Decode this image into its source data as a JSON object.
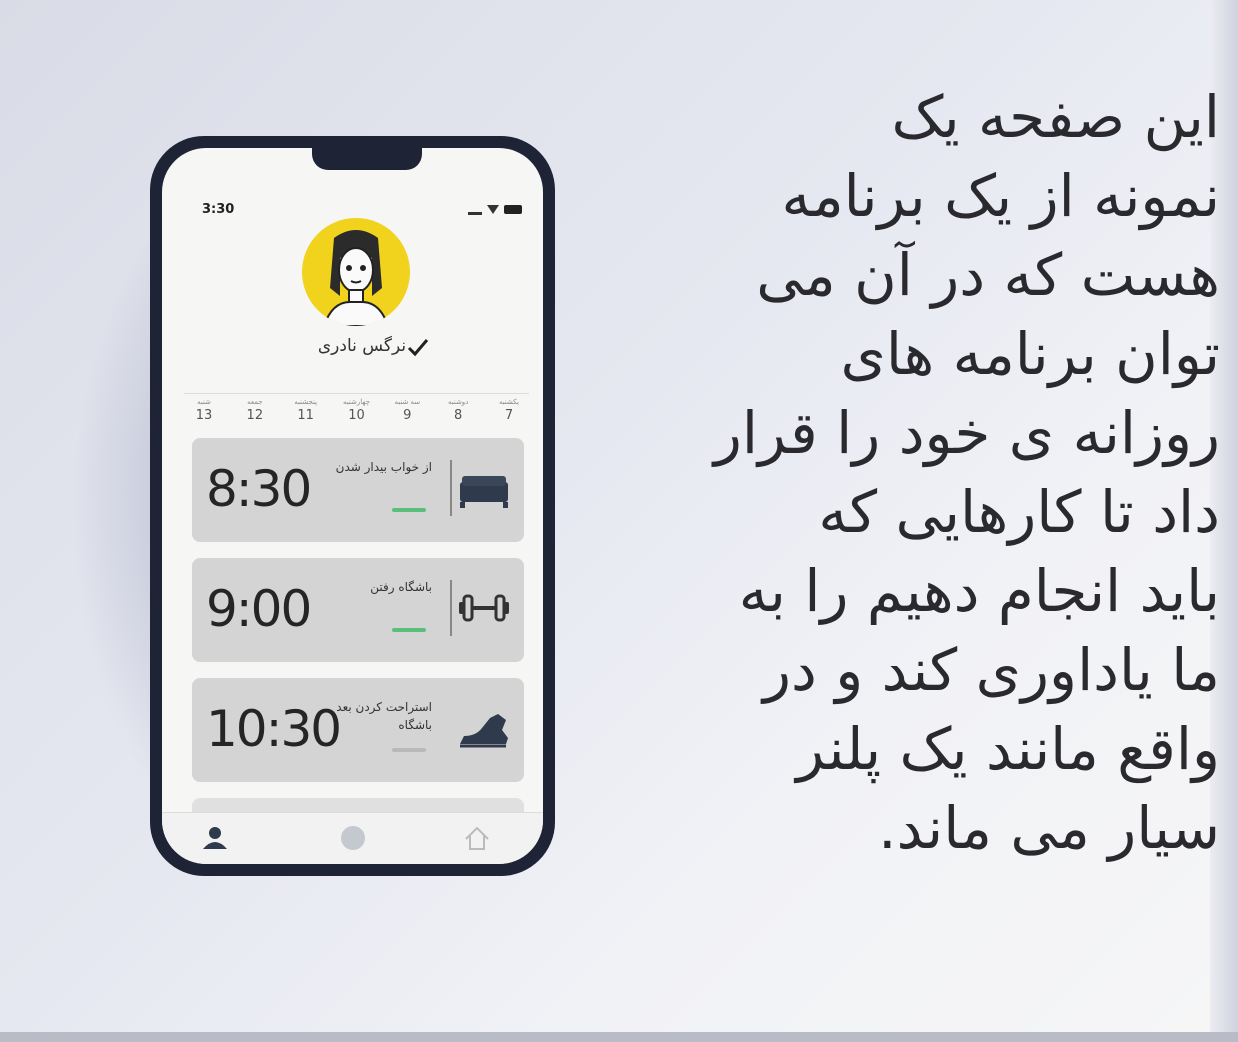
{
  "phone": {
    "status_time": "3:30",
    "user_name": "نرگس نادری",
    "days": [
      {
        "name": "شنبه",
        "num": "13"
      },
      {
        "name": "جمعه",
        "num": "12"
      },
      {
        "name": "پنجشنبه",
        "num": "11"
      },
      {
        "name": "چهارشنبه",
        "num": "10"
      },
      {
        "name": "سه شنبه",
        "num": "9"
      },
      {
        "name": "دوشنبه",
        "num": "8"
      },
      {
        "name": "یکشنبه",
        "num": "7"
      }
    ],
    "cards": [
      {
        "time": "8:30",
        "title": "از خواب بیدار شدن",
        "icon": "bed-icon"
      },
      {
        "time": "9:00",
        "title": "باشگاه رفتن",
        "icon": "dumbbell-icon"
      },
      {
        "time": "10:30",
        "title": "استراحت کردن بعد باشگاه",
        "icon": "sneaker-icon"
      }
    ],
    "tabs": [
      "profile-icon",
      "circle-icon",
      "home-icon"
    ]
  },
  "description": "این صفحه یک\nنمونه از یک برنامه\nهست که در آن می\nتوان برنامه های\nروزانه ی خود را قرار\nداد تا کارهایی که\nباید انجام دهیم را به\nما یاداوری کند و در\nواقع مانند یک پلنر\nسیار می ماند.",
  "colors": {
    "avatar_bg": "#f1d21c",
    "card_bg": "#d4d4d4",
    "status_green": "#5bbf7c"
  }
}
